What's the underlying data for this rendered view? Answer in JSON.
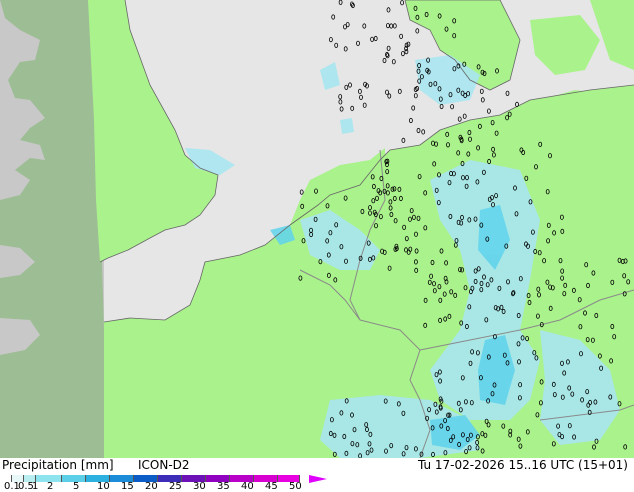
{
  "title": "Precipitation [mm]",
  "model": "ICON-D2",
  "valid_time": "Tu 17-02-2026 15..16 UTC (15+01)",
  "legend": {
    "ticks": [
      "0.1",
      "0.5",
      "1",
      "2",
      "5",
      "10",
      "15",
      "20",
      "25",
      "30",
      "35",
      "40",
      "45",
      "50"
    ],
    "colors": [
      "#ffffff",
      "#e8f8f8",
      "#b8eef0",
      "#8ee4ee",
      "#5ccfe8",
      "#2cb0e0",
      "#1c8cd8",
      "#0c5cc8",
      "#3c2cb8",
      "#6c10b8",
      "#9000c0",
      "#b800c8",
      "#d800d0",
      "#e800e0"
    ]
  },
  "map_colors": {
    "water": "#e6e6e6",
    "land_domain": "#aaf28c",
    "outside_domain": "#c8c8c8",
    "outside_land": "#9dbd94",
    "precip_light": "#a8e6f0",
    "precip_medium": "#5fd3ec",
    "border": "#9a9a9a"
  }
}
